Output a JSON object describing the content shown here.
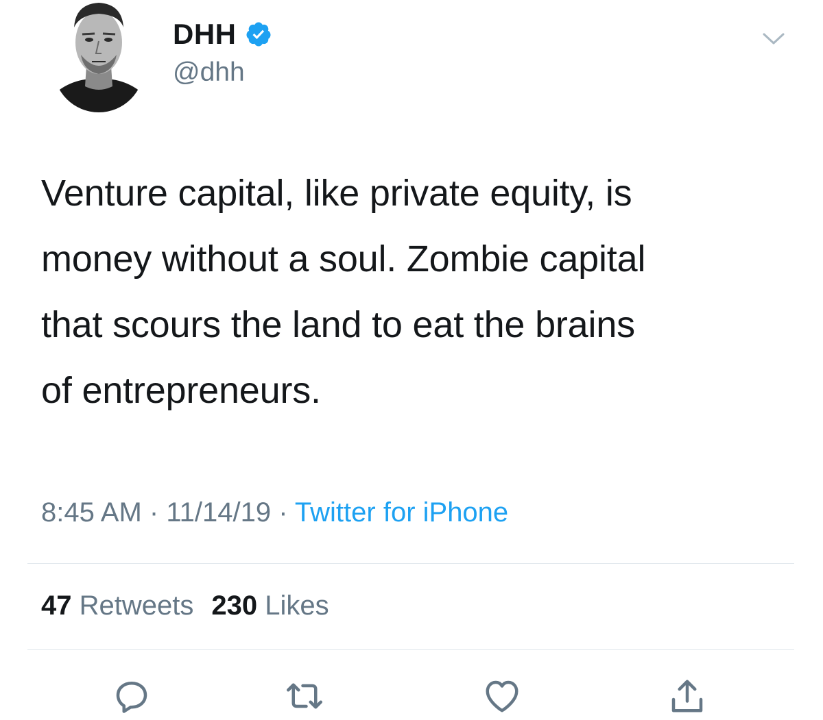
{
  "author": {
    "display_name": "DHH",
    "handle": "@dhh",
    "verified": true,
    "avatar_icon": "person-avatar"
  },
  "tweet": {
    "text": "Venture capital, like private equity, is\nmoney without a soul. Zombie capital\nthat scours the land to eat the brains\nof entrepreneurs.",
    "time": "8:45 AM",
    "date": "11/14/19",
    "separator": "·",
    "source": "Twitter for iPhone"
  },
  "stats": {
    "retweets_count": "47",
    "retweets_label": "Retweets",
    "likes_count": "230",
    "likes_label": "Likes"
  },
  "actions": [
    {
      "icon": "reply-icon"
    },
    {
      "icon": "retweet-icon"
    },
    {
      "icon": "like-icon"
    },
    {
      "icon": "share-icon"
    }
  ],
  "colors": {
    "text": "#14171a",
    "secondary": "#657786",
    "link": "#1da1f2",
    "verified": "#1da1f2",
    "divider": "#e1e8ed"
  }
}
